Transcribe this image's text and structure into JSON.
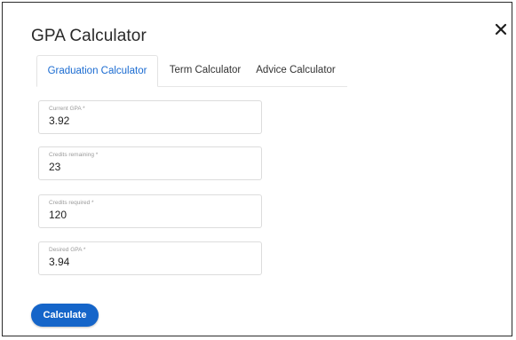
{
  "dialog": {
    "title": "GPA Calculator",
    "close_icon": "close-icon"
  },
  "tabs": [
    {
      "label": "Graduation Calculator",
      "active": true
    },
    {
      "label": "Term Calculator",
      "active": false
    },
    {
      "label": "Advice Calculator",
      "active": false
    }
  ],
  "fields": [
    {
      "label": "Current GPA *",
      "value": "3.92"
    },
    {
      "label": "Credits remaining *",
      "value": "23"
    },
    {
      "label": "Credits required *",
      "value": "120"
    },
    {
      "label": "Desired GPA *",
      "value": "3.94"
    }
  ],
  "actions": {
    "calculate_label": "Calculate"
  },
  "colors": {
    "accent": "#1565c9",
    "active_tab_text": "#1a6bd1",
    "border": "#dcdcdc"
  }
}
